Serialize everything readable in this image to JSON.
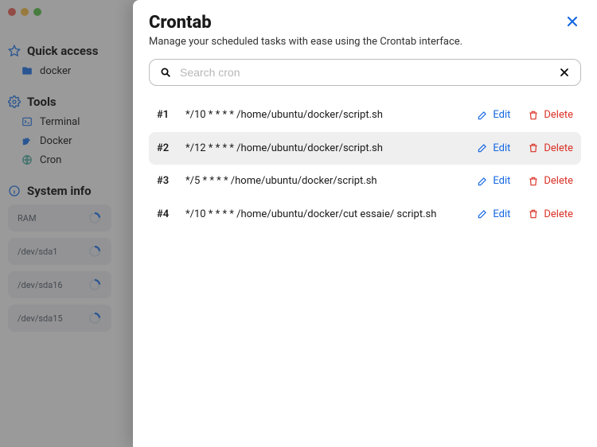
{
  "sidebar": {
    "quick": {
      "title": "Quick access",
      "items": [
        {
          "label": "docker",
          "icon": "folder-icon"
        }
      ]
    },
    "tools": {
      "title": "Tools",
      "items": [
        {
          "label": "Terminal",
          "icon": "terminal-icon"
        },
        {
          "label": "Docker",
          "icon": "docker-icon"
        },
        {
          "label": "Cron",
          "icon": "globe-icon"
        }
      ]
    },
    "sysinfo": {
      "title": "System info",
      "items": [
        {
          "label": "RAM"
        },
        {
          "label": "/dev/sda1"
        },
        {
          "label": "/dev/sda16"
        },
        {
          "label": "/dev/sda15"
        }
      ]
    }
  },
  "panel": {
    "title": "Crontab",
    "subtitle": "Manage your scheduled tasks with ease using the Crontab interface.",
    "search_placeholder": "Search cron",
    "edit_label": "Edit",
    "delete_label": "Delete",
    "rows": [
      {
        "idx": "#1",
        "cmd": "*/10 * * * * /home/ubuntu/docker/script.sh",
        "hover": false
      },
      {
        "idx": "#2",
        "cmd": "*/12 * * * * /home/ubuntu/docker/script.sh",
        "hover": true
      },
      {
        "idx": "#3",
        "cmd": "*/5 * * * * /home/ubuntu/docker/script.sh",
        "hover": false
      },
      {
        "idx": "#4",
        "cmd": "*/10 * * * * /home/ubuntu/docker/cut essaie/ script.sh",
        "hover": false
      }
    ]
  },
  "colors": {
    "accent_blue": "#1266e3",
    "accent_red": "#d93025",
    "icon_blue": "#2b7de9",
    "icon_teal": "#4aa8a0"
  }
}
